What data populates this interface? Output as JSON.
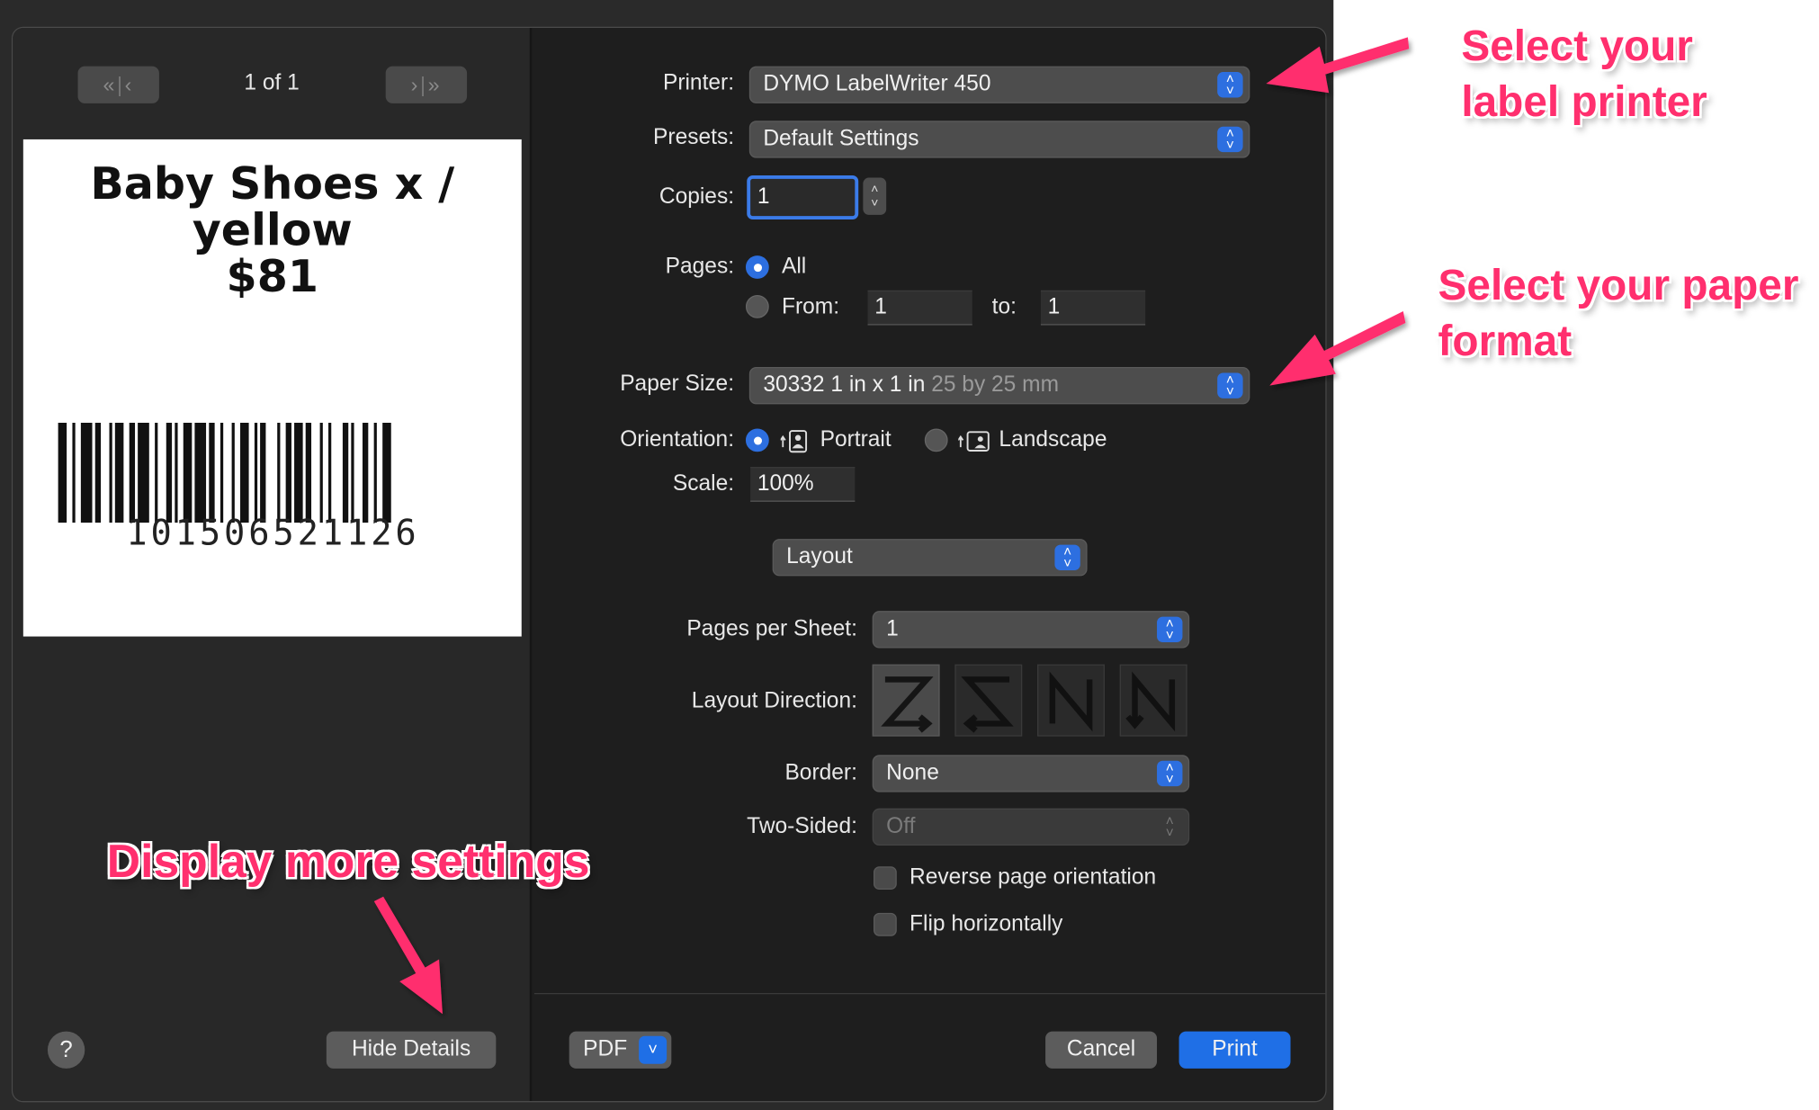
{
  "preview": {
    "page_indicator": "1 of 1",
    "label_lines": [
      "Baby Shoes x /",
      "yellow",
      "$81"
    ],
    "barcode_number": "101506521126"
  },
  "form": {
    "printer_label": "Printer:",
    "printer_value": "DYMO LabelWriter 450",
    "presets_label": "Presets:",
    "presets_value": "Default Settings",
    "copies_label": "Copies:",
    "copies_value": "1",
    "pages_label": "Pages:",
    "pages_all": "All",
    "pages_from_label": "From:",
    "pages_from_value": "1",
    "pages_to_label": "to:",
    "pages_to_value": "1",
    "paper_size_label": "Paper Size:",
    "paper_size_value": "30332 1 in x 1 in",
    "paper_size_dim": "25 by 25 mm",
    "orientation_label": "Orientation:",
    "orientation_portrait": "Portrait",
    "orientation_landscape": "Landscape",
    "scale_label": "Scale:",
    "scale_value": "100%",
    "section_value": "Layout",
    "pages_per_sheet_label": "Pages per Sheet:",
    "pages_per_sheet_value": "1",
    "layout_direction_label": "Layout Direction:",
    "border_label": "Border:",
    "border_value": "None",
    "two_sided_label": "Two-Sided:",
    "two_sided_value": "Off",
    "reverse_label": "Reverse page orientation",
    "flip_label": "Flip horizontally"
  },
  "buttons": {
    "help": "?",
    "hide_details": "Hide Details",
    "pdf": "PDF",
    "cancel": "Cancel",
    "print": "Print"
  },
  "annotations": {
    "printer": [
      "Select your",
      "label printer"
    ],
    "paper": [
      "Select your paper",
      "format"
    ],
    "details": "Display more settings"
  },
  "colors": {
    "annotation": "#ff2f6e",
    "accent": "#1f6fe6",
    "dialog_bg": "#1e1e1e"
  }
}
